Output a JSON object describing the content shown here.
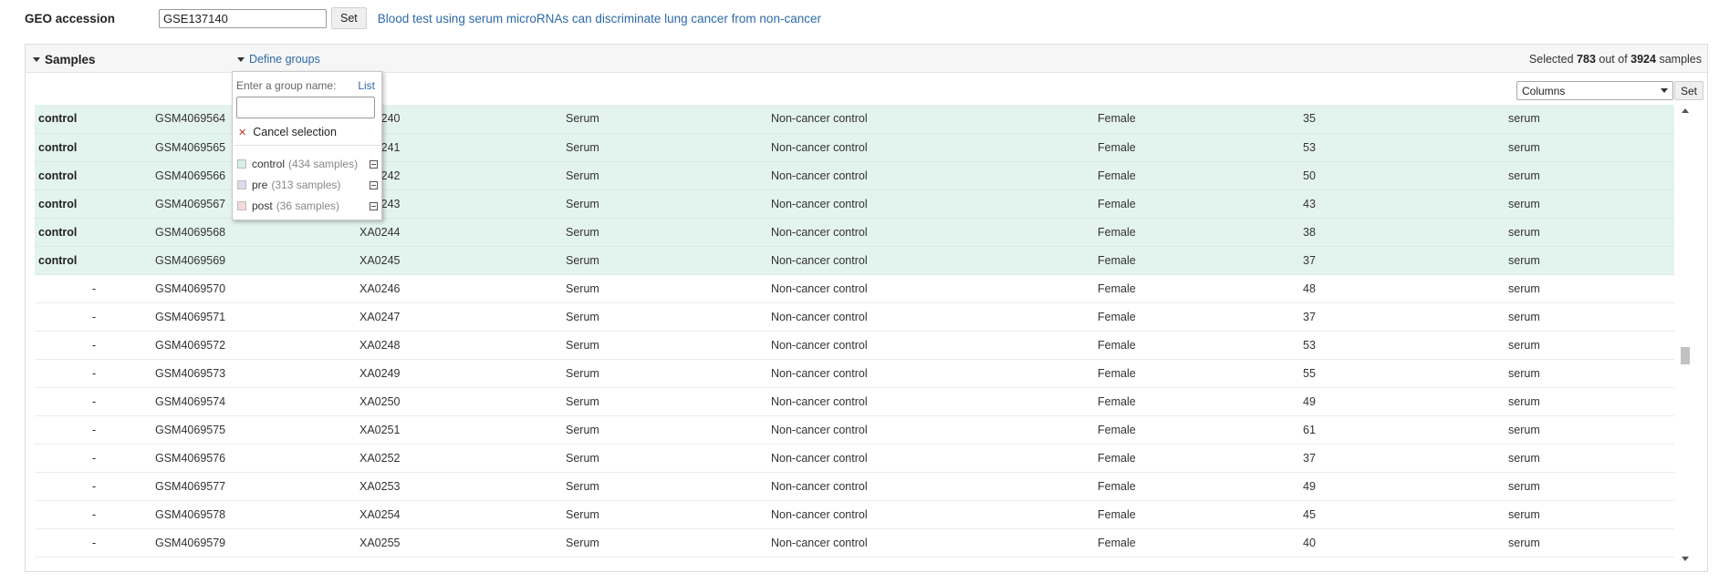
{
  "geo": {
    "label": "GEO accession",
    "accession_value": "GSE137140",
    "set_label": "Set",
    "dataset_title": "Blood test using serum microRNAs can discriminate lung cancer from non-cancer"
  },
  "samples_panel": {
    "title": "Samples",
    "define_groups_label": "Define groups",
    "selected_prefix": "Selected",
    "selected_count": "783",
    "selected_middle": "out of",
    "total_count": "3924",
    "selected_suffix": "samples",
    "columns_select_value": "Columns",
    "columns_set_label": "Set"
  },
  "define_groups": {
    "prompt": "Enter a group name:",
    "list_link": "List",
    "group_name_value": "",
    "cancel_selection": "Cancel selection",
    "groups": [
      {
        "name": "control",
        "count": "(434 samples)",
        "color": "#d9eee6"
      },
      {
        "name": "pre",
        "count": "(313 samples)",
        "color": "#dcdcf0"
      },
      {
        "name": "post",
        "count": "(36 samples)",
        "color": "#f5dada"
      }
    ]
  },
  "colors": {
    "link": "#2e6aa6",
    "selected_row_bg": "#e3f3ee"
  },
  "rows": [
    {
      "group": "control",
      "gsm": "GSM4069564",
      "id": "XA0240",
      "source": "Serum",
      "disease": "Non-cancer control",
      "sex": "Female",
      "age": "35",
      "type": "serum",
      "selected": true
    },
    {
      "group": "control",
      "gsm": "GSM4069565",
      "id": "XA0241",
      "source": "Serum",
      "disease": "Non-cancer control",
      "sex": "Female",
      "age": "53",
      "type": "serum",
      "selected": true
    },
    {
      "group": "control",
      "gsm": "GSM4069566",
      "id": "XA0242",
      "source": "Serum",
      "disease": "Non-cancer control",
      "sex": "Female",
      "age": "50",
      "type": "serum",
      "selected": true
    },
    {
      "group": "control",
      "gsm": "GSM4069567",
      "id": "XA0243",
      "source": "Serum",
      "disease": "Non-cancer control",
      "sex": "Female",
      "age": "43",
      "type": "serum",
      "selected": true
    },
    {
      "group": "control",
      "gsm": "GSM4069568",
      "id": "XA0244",
      "source": "Serum",
      "disease": "Non-cancer control",
      "sex": "Female",
      "age": "38",
      "type": "serum",
      "selected": true
    },
    {
      "group": "control",
      "gsm": "GSM4069569",
      "id": "XA0245",
      "source": "Serum",
      "disease": "Non-cancer control",
      "sex": "Female",
      "age": "37",
      "type": "serum",
      "selected": true
    },
    {
      "group": "-",
      "gsm": "GSM4069570",
      "id": "XA0246",
      "source": "Serum",
      "disease": "Non-cancer control",
      "sex": "Female",
      "age": "48",
      "type": "serum",
      "selected": false
    },
    {
      "group": "-",
      "gsm": "GSM4069571",
      "id": "XA0247",
      "source": "Serum",
      "disease": "Non-cancer control",
      "sex": "Female",
      "age": "37",
      "type": "serum",
      "selected": false
    },
    {
      "group": "-",
      "gsm": "GSM4069572",
      "id": "XA0248",
      "source": "Serum",
      "disease": "Non-cancer control",
      "sex": "Female",
      "age": "53",
      "type": "serum",
      "selected": false
    },
    {
      "group": "-",
      "gsm": "GSM4069573",
      "id": "XA0249",
      "source": "Serum",
      "disease": "Non-cancer control",
      "sex": "Female",
      "age": "55",
      "type": "serum",
      "selected": false
    },
    {
      "group": "-",
      "gsm": "GSM4069574",
      "id": "XA0250",
      "source": "Serum",
      "disease": "Non-cancer control",
      "sex": "Female",
      "age": "49",
      "type": "serum",
      "selected": false
    },
    {
      "group": "-",
      "gsm": "GSM4069575",
      "id": "XA0251",
      "source": "Serum",
      "disease": "Non-cancer control",
      "sex": "Female",
      "age": "61",
      "type": "serum",
      "selected": false
    },
    {
      "group": "-",
      "gsm": "GSM4069576",
      "id": "XA0252",
      "source": "Serum",
      "disease": "Non-cancer control",
      "sex": "Female",
      "age": "37",
      "type": "serum",
      "selected": false
    },
    {
      "group": "-",
      "gsm": "GSM4069577",
      "id": "XA0253",
      "source": "Serum",
      "disease": "Non-cancer control",
      "sex": "Female",
      "age": "49",
      "type": "serum",
      "selected": false
    },
    {
      "group": "-",
      "gsm": "GSM4069578",
      "id": "XA0254",
      "source": "Serum",
      "disease": "Non-cancer control",
      "sex": "Female",
      "age": "45",
      "type": "serum",
      "selected": false
    },
    {
      "group": "-",
      "gsm": "GSM4069579",
      "id": "XA0255",
      "source": "Serum",
      "disease": "Non-cancer control",
      "sex": "Female",
      "age": "40",
      "type": "serum",
      "selected": false
    }
  ]
}
